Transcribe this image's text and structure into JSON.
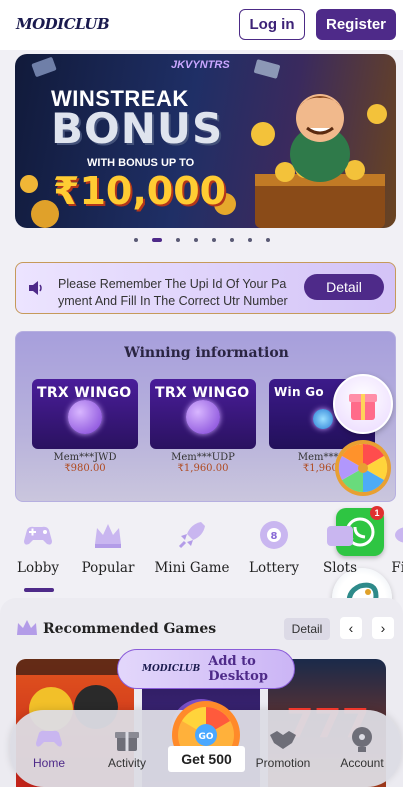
{
  "header": {
    "logo": "MODICLUB",
    "login_label": "Log in",
    "register_label": "Register"
  },
  "banner": {
    "brand": "JKVYNTRS",
    "line1": "WINSTREAK",
    "line2": "BONUS",
    "line3": "WITH BONUS UP TO",
    "line4": "₹10,000",
    "slide_count": 8,
    "active_slide": 2
  },
  "notice": {
    "line1": "Please Remember The Upi Id Of Your Pa",
    "line2": "yment And Fill In The Correct Utr Number",
    "detail_label": "Detail"
  },
  "winning": {
    "title": "Winning information",
    "items": [
      {
        "game": "TRX WINGO",
        "member": "Mem***JWD",
        "amount": "₹980.00"
      },
      {
        "game": "TRX WINGO",
        "member": "Mem***UDP",
        "amount": "₹1,960.00"
      },
      {
        "game": "Win Go",
        "member": "Mem***C",
        "amount": "₹1,960."
      }
    ]
  },
  "categories": [
    {
      "label": "Lobby",
      "icon": "gamepad-icon",
      "active": true
    },
    {
      "label": "Popular",
      "icon": "crown-icon"
    },
    {
      "label": "Mini Game",
      "icon": "rocket-icon"
    },
    {
      "label": "Lottery",
      "icon": "lottery-ball-icon"
    },
    {
      "label": "Slots",
      "icon": "slots-icon"
    },
    {
      "label": "Fish",
      "icon": "fish-icon"
    }
  ],
  "recommended": {
    "title": "Recommended Games",
    "detail_label": "Detail",
    "prev": "‹",
    "next": "›"
  },
  "add_to_desktop": {
    "brand": "MODICLUB",
    "label": "Add to Desktop"
  },
  "floating": {
    "whatsapp_badge": "1"
  },
  "tabbar": {
    "home": "Home",
    "activity": "Activity",
    "get500": "Get 500",
    "promotion": "Promotion",
    "account": "Account"
  },
  "colors": {
    "primary": "#4e2a89",
    "gold": "#ffcc33",
    "background": "#f1f0f5"
  }
}
